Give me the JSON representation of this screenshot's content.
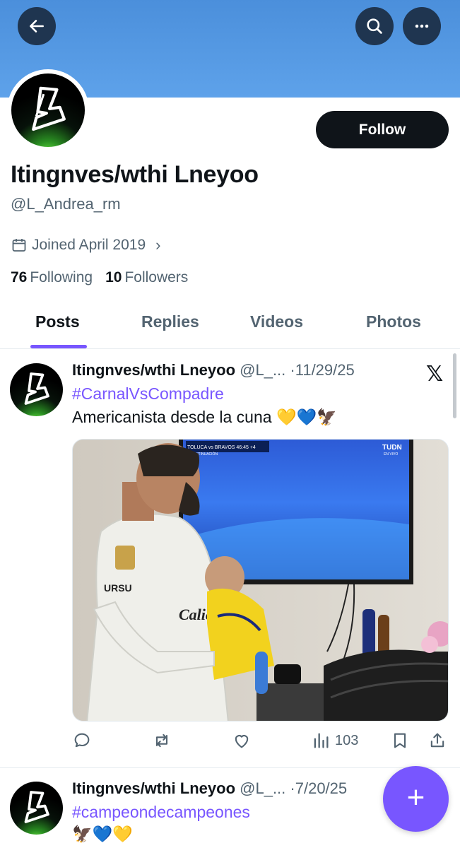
{
  "header": {
    "back_icon": "arrow-left-icon",
    "search_icon": "search-icon",
    "more_icon": "more-horizontal-icon",
    "banner_color": "#5ea2ea"
  },
  "profile": {
    "display_name": "Itingnves/wthi Lneyoo",
    "handle": "@L_Andrea_rm",
    "follow_label": "Follow",
    "joined_text": "Joined April 2019",
    "following_count": "76",
    "following_label": "Following",
    "followers_count": "10",
    "followers_label": "Followers"
  },
  "tabs": [
    {
      "label": "Posts",
      "active": true
    },
    {
      "label": "Replies",
      "active": false
    },
    {
      "label": "Videos",
      "active": false
    },
    {
      "label": "Photos",
      "active": false
    }
  ],
  "posts": [
    {
      "name": "Itingnves/wthi Lneyoo",
      "handle_truncated": "@L_...",
      "date": "11/29/25",
      "hashtag": "#CarnalVsCompadre",
      "text": "Americanista desde la cuna 💛💙🦅",
      "image_tv_label": "TUDN",
      "image_tv_sublabel": "EN VIVO",
      "image_score_bar": "TOLUCA vs BRAVOS  46:45  +4",
      "image_score_sub": "A CONTINUACIÓN",
      "image_shirt_text": "Caliente",
      "image_shirt_brand": "URSU",
      "views": "103"
    },
    {
      "name": "Itingnves/wthi Lneyoo",
      "handle_truncated": "@L_...",
      "date": "7/20/25",
      "hashtag": "#campeondecampeones",
      "text": "🦅💙💛"
    }
  ],
  "accent_color": "#7856ff"
}
